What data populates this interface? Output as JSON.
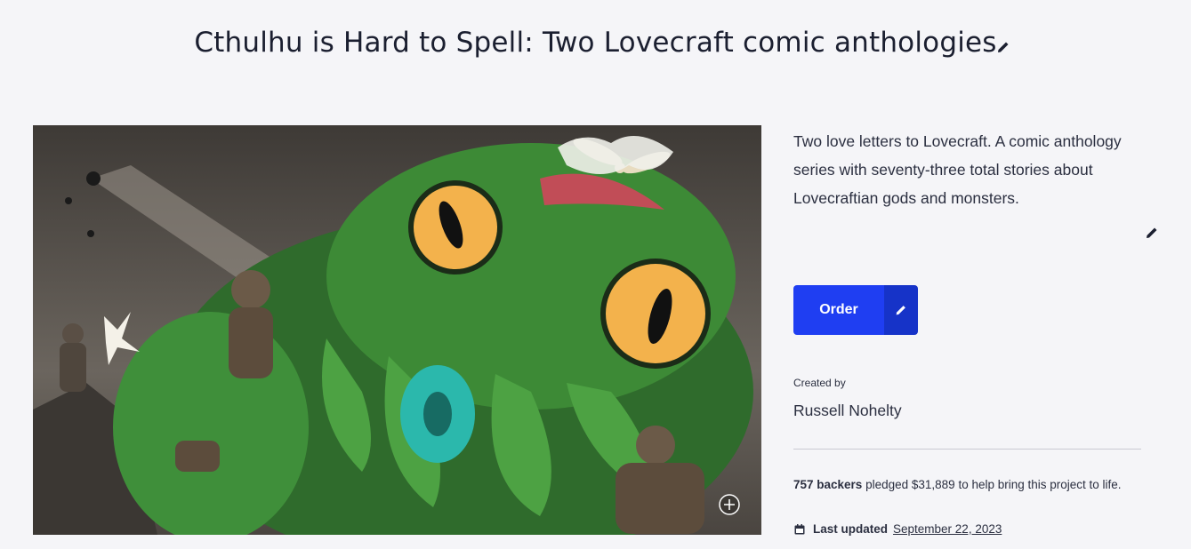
{
  "project": {
    "title": "Cthulhu is Hard to Spell: Two Lovecraft comic anthologies",
    "blurb": "Two love letters to Lovecraft. A comic anthology series with seventy-three total stories about Lovecraftian gods and monsters.",
    "order_label": "Order",
    "created_by_label": "Created by",
    "creator_name": "Russell Nohelty",
    "backers_count": "757 backers",
    "pledged_text": "pledged $31,889 to help bring this project to life.",
    "last_updated_label": "Last updated",
    "last_updated_date": "September 22, 2023"
  },
  "icons": {
    "title_edit": "pencil-icon",
    "blurb_edit": "pencil-icon",
    "order_edit": "pencil-icon",
    "zoom": "plus-circle-icon",
    "calendar": "calendar-icon"
  },
  "colors": {
    "accent": "#1f3ef2",
    "accent_dark": "#1633c8",
    "background": "#f5f5f8"
  }
}
